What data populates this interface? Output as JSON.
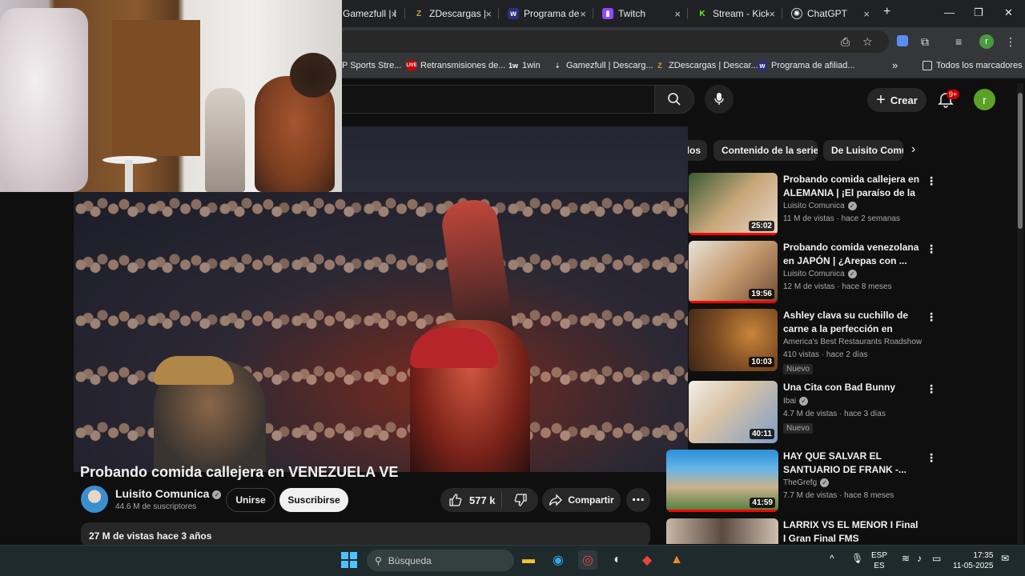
{
  "browser": {
    "tabs": [
      {
        "label": "Gamezfull | D",
        "icon": "gamezfull-icon",
        "close": "×"
      },
      {
        "label": "ZDescargas |",
        "icon": "zdescargas-icon",
        "close": "×"
      },
      {
        "label": "Programa de",
        "icon": "affiliate-icon",
        "close": "×"
      },
      {
        "label": "Twitch",
        "icon": "twitch-icon",
        "close": "×"
      },
      {
        "label": "Stream - Kick",
        "icon": "kick-icon",
        "close": "×"
      },
      {
        "label": "ChatGPT",
        "icon": "chatgpt-icon",
        "close": "×"
      }
    ],
    "new_tab": "+",
    "bookmarks": [
      {
        "label": "P Sports Stre..."
      },
      {
        "label": "Retransmisiones de..."
      },
      {
        "label": "1win"
      },
      {
        "label": "Gamezfull | Descarg..."
      },
      {
        "label": "ZDescargas | Descar..."
      },
      {
        "label": "Programa de afiliad..."
      }
    ],
    "bookmarks_more": "»",
    "all_bookmarks": "Todos los marcadores",
    "profile_initial": "r"
  },
  "youtube": {
    "create_label": "Crear",
    "notification_badge": "9+",
    "avatar_initial": "r",
    "video_title": "Probando comida callejera en VENEZUELA VE",
    "channel": {
      "name": "Luisito Comunica",
      "subscribers": "44.6 M de suscriptores"
    },
    "join_label": "Unirse",
    "subscribe_label": "Suscribirse",
    "likes": "577 k",
    "share_label": "Compartir",
    "description_meta": "27 M de vistas  hace 3 años",
    "chips": [
      {
        "label": "dos"
      },
      {
        "label": "Contenido de la serie"
      },
      {
        "label": "De Luisito Comu"
      }
    ],
    "recommendations": [
      {
        "title": "Probando comida callejera en ALEMANIA | ¡El paraíso de la ...",
        "channel": "Luisito Comunica",
        "meta": "11 M de vistas · hace 2 semanas",
        "duration": "25:02",
        "badge": "",
        "progress": 1.0
      },
      {
        "title": "Probando comida venezolana en JAPÓN | ¿Arepas con ...",
        "channel": "Luisito Comunica",
        "meta": "12 M de vistas · hace 8 meses",
        "duration": "19:56",
        "badge": "",
        "progress": 1.0
      },
      {
        "title": "Ashley clava su cuchillo de carne a la perfección en Bandi...",
        "channel": "America's Best Restaurants Roadshow",
        "meta": "410 vistas · hace 2 días",
        "duration": "10:03",
        "badge": "Nuevo",
        "progress": 0
      },
      {
        "title": "Una Cita con Bad Bunny",
        "channel": "Ibai",
        "meta": "4.7 M de vistas · hace 3 días",
        "duration": "40:11",
        "badge": "Nuevo",
        "progress": 0
      },
      {
        "title": "HAY QUE SALVAR EL SANTUARIO DE FRANK -...",
        "channel": "TheGrefg",
        "meta": "7.7 M de vistas · hace 8 meses",
        "duration": "41:59",
        "badge": "",
        "progress": 1.0
      },
      {
        "title": "LARRIX VS EL MENOR I Final I Gran Final FMS Internacional ...",
        "channel": "",
        "meta": "",
        "duration": "",
        "badge": "",
        "progress": 0
      }
    ]
  },
  "taskbar": {
    "search_placeholder": "Búsqueda",
    "language": "ESP",
    "language_sub": "ES",
    "time": "17:35",
    "date": "11-05-2025"
  }
}
